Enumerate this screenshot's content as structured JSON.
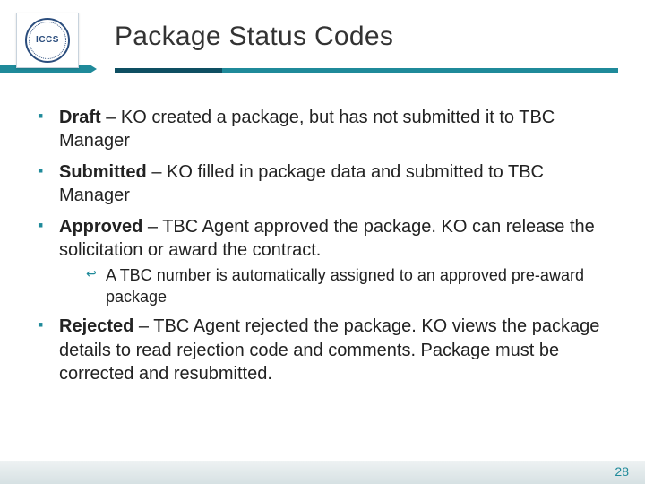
{
  "colors": {
    "accent": "#1f8a9a",
    "accent_dark": "#0e4f62",
    "text": "#222222"
  },
  "header": {
    "logo_text": "ICCS",
    "title": "Package Status Codes"
  },
  "bullets": [
    {
      "term": "Draft",
      "rest": " – KO created a package, but has not submitted it to TBC Manager"
    },
    {
      "term": "Submitted",
      "rest": " – KO filled in package data and submitted to TBC Manager"
    },
    {
      "term": "Approved",
      "rest": " – TBC Agent approved the package. KO can release the solicitation or award the contract.",
      "sub": [
        "A TBC number is automatically assigned to an approved pre-award package"
      ]
    },
    {
      "term": "Rejected",
      "rest": " – TBC Agent rejected the package. KO views the package details to read rejection code and comments. Package must be corrected and resubmitted."
    }
  ],
  "page_number": "28"
}
